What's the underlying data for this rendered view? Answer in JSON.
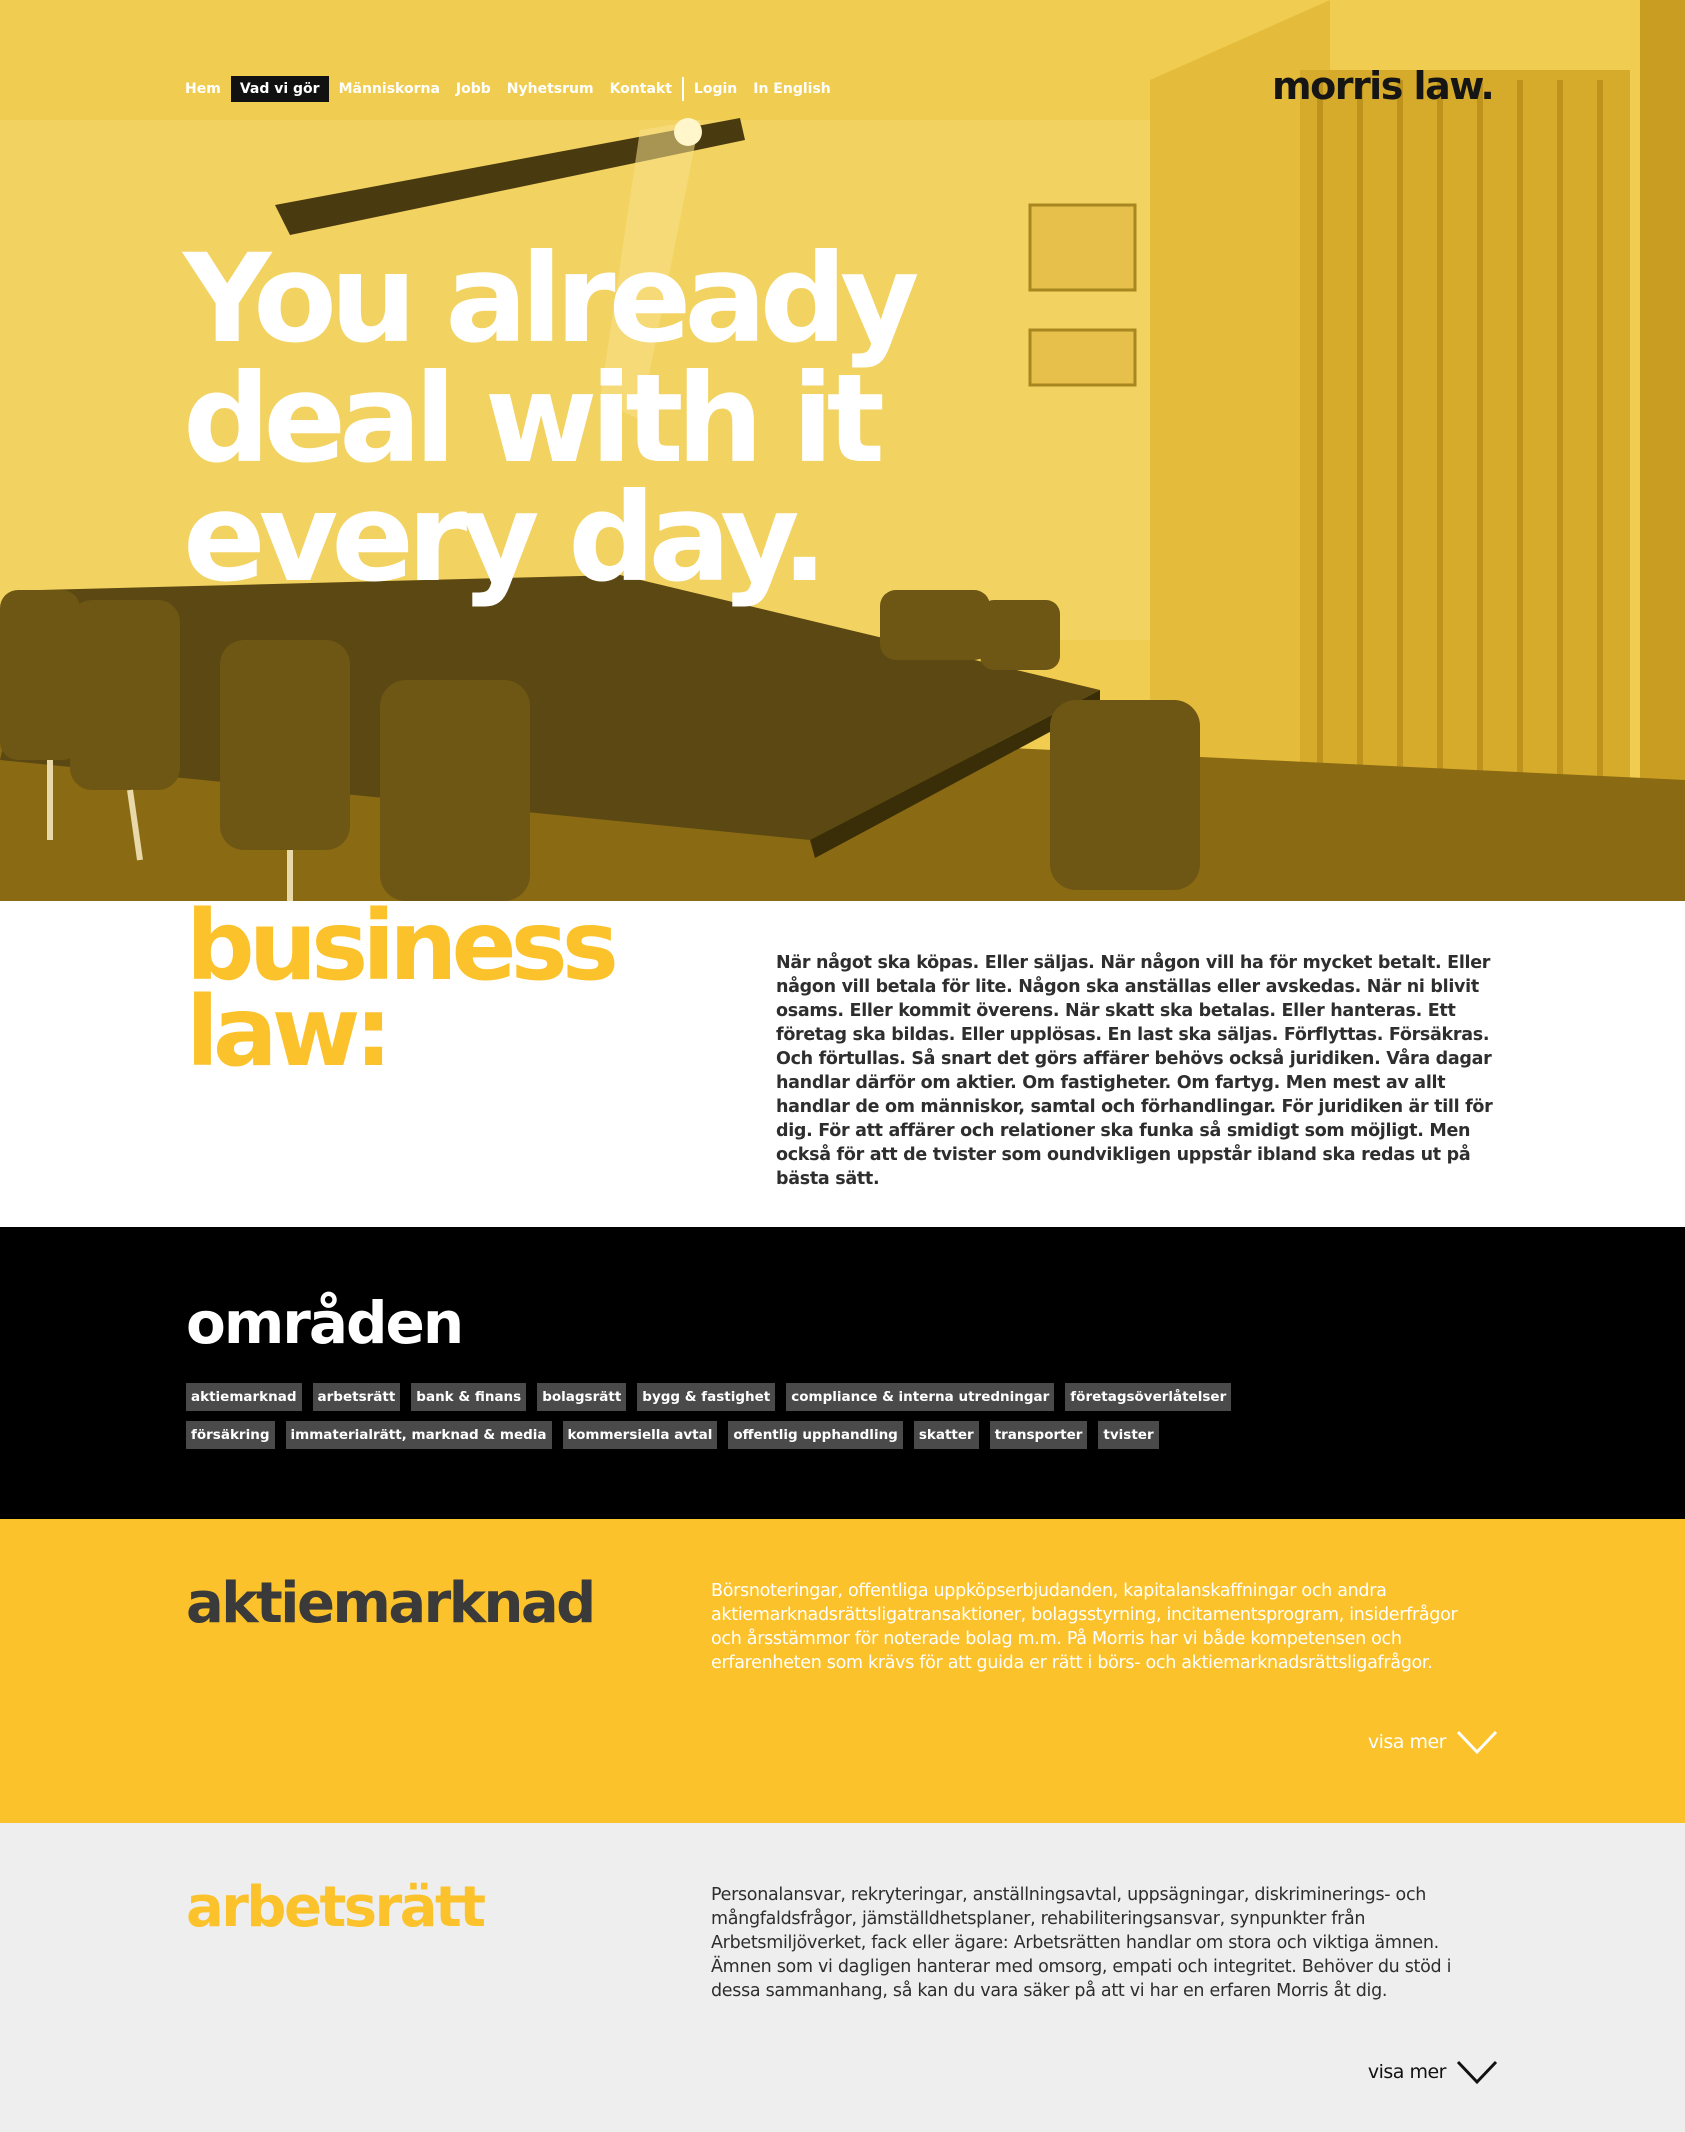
{
  "nav": {
    "items": [
      {
        "label": "Hem",
        "active": false
      },
      {
        "label": "Vad vi gör",
        "active": true
      },
      {
        "label": "Människorna",
        "active": false
      },
      {
        "label": "Jobb",
        "active": false
      },
      {
        "label": "Nyhetsrum",
        "active": false
      },
      {
        "label": "Kontakt",
        "active": false
      }
    ],
    "login": "Login",
    "english": "In English"
  },
  "logo": "morris law.",
  "hero": {
    "title_lines": [
      "You already",
      "deal with it",
      "every day."
    ]
  },
  "intro": {
    "title_lines": [
      "business",
      "law:"
    ],
    "text": "När något ska köpas. Eller säljas. När någon vill ha för mycket betalt. Eller någon vill betala för lite. Någon ska anställas eller avskedas. När ni blivit osams. Eller kommit överens. När skatt ska betalas. Eller hanteras. Ett företag ska bildas. Eller upplösas. En last ska säljas. Förflyttas. Försäkras. Och förtullas. Så snart det görs affärer behövs också juridiken. Våra dagar handlar därför om aktier. Om fastigheter. Om fartyg. Men mest av allt handlar de om människor, samtal och förhandlingar. För juridiken är till för dig. För att affärer och relationer ska funka så smidigt som möjligt. Men också för att de tvister som oundvikligen uppstår ibland ska redas ut på bästa sätt."
  },
  "areas": {
    "title": "områden",
    "tags": [
      "aktiemarknad",
      "arbetsrätt",
      "bank & finans",
      "bolagsrätt",
      "bygg & fastighet",
      "compliance & interna utredningar",
      "företagsöverlåtelser",
      "försäkring",
      "immaterialrätt, marknad & media",
      "kommersiella avtal",
      "offentlig upphandling",
      "skatter",
      "transporter",
      "tvister"
    ]
  },
  "sections": {
    "aktiemarknad": {
      "title": "aktiemarknad",
      "text": "Börsnoteringar, offentliga uppköpserbjudanden, kapitalanskaffningar och andra aktiemarknadsrättsligatransaktioner, bolagsstyrning, incitamentsprogram, insiderfrågor och årsstämmor för noterade bolag m.m. På Morris har vi både kompetensen och erfarenheten som krävs för att guida er rätt i börs- och aktiemarknadsrättsligafrågor.",
      "more": "visa mer"
    },
    "arbetsratt": {
      "title": "arbetsrätt",
      "text": "Personalansvar, rekryteringar, anställningsavtal, uppsägningar, diskriminerings- och mångfaldsfrågor, jämställdhetsplaner, rehabiliteringsansvar, synpunkter från Arbetsmiljöverket, fack eller ägare: Arbetsrätten handlar om stora och viktiga ämnen. Ämnen som vi dagligen hanterar med omsorg, empati och integritet. Behöver du stöd i dessa sammanhang, så kan du vara säker på att vi har en erfaren Morris åt dig.",
      "more": "visa mer"
    }
  },
  "colors": {
    "brand_yellow": "#fcc22b",
    "dark": "#000000",
    "tag_bg": "#4a4a4a",
    "light_gray": "#eeeeee"
  }
}
